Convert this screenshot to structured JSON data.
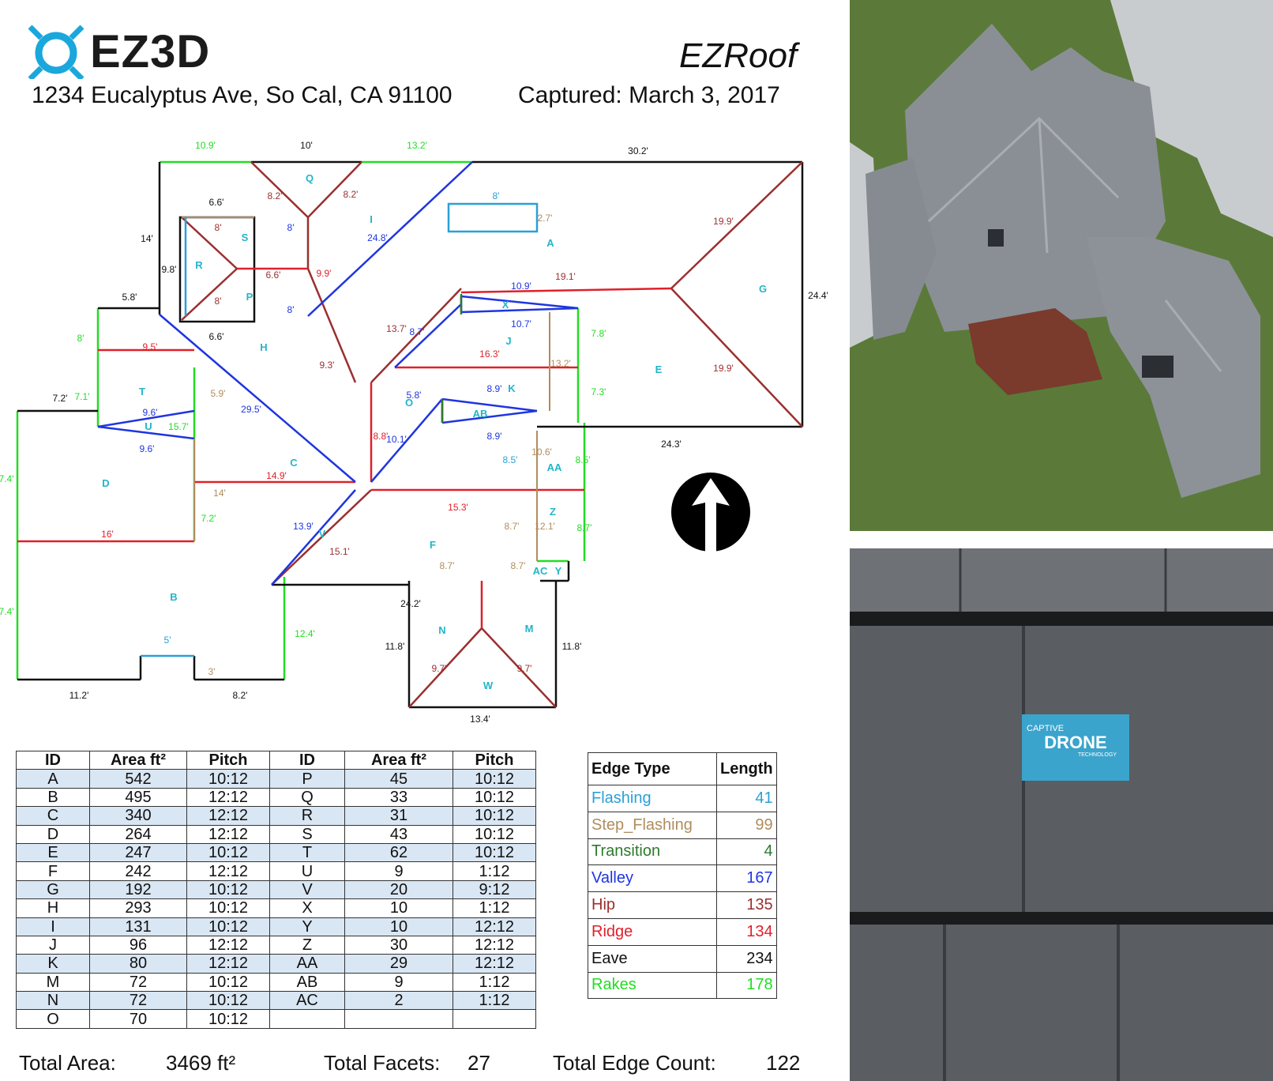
{
  "header": {
    "logo_text": "EZ3D",
    "address": "1234 Eucalyptus Ave, So Cal, CA 91100",
    "product": "EZRoof",
    "captured": "Captured: March 3, 2017"
  },
  "colors": {
    "flashing": "#2aa0d8",
    "step_flashing": "#b08d5c",
    "transition": "#2d7a2d",
    "valley": "#1f35e0",
    "hip": "#9b2f2f",
    "ridge": "#e0202a",
    "eave": "#111111",
    "rakes": "#22dd22",
    "facet_label": "#22b5c8",
    "row_highlight": "#d9e6f3"
  },
  "diagram": {
    "facet_labels": [
      "A",
      "B",
      "C",
      "D",
      "E",
      "F",
      "G",
      "H",
      "I",
      "J",
      "K",
      "M",
      "N",
      "O",
      "P",
      "Q",
      "R",
      "S",
      "T",
      "U",
      "V",
      "W",
      "X",
      "Y",
      "Z",
      "AA",
      "AB",
      "AC"
    ],
    "dimensions": {
      "top_rake_1": "10.9'",
      "top_eave_1": "10'",
      "top_rake_2": "13.2'",
      "top_eave_2": "30.2'",
      "right_eave": "24.4'",
      "left_14": "14'",
      "eave_5_8": "5.8'",
      "eave_6_6_top": "6.6'",
      "eave_6_6_bottom": "6.6'",
      "side_9_8": "9.8'",
      "hip_8_2a": "8.2'",
      "hip_8_2b": "8.2'",
      "valley_8a": "8'",
      "valley_8b": "8'",
      "hip_8a": "8'",
      "hip_8b": "8'",
      "ridge_6_6": "6.6'",
      "hip_9_9": "9.9'",
      "valley_24_8": "24.8'",
      "flash_8": "8'",
      "step_2_7": "2.7'",
      "hip_19_9a": "19.9'",
      "hip_19_9b": "19.9'",
      "ridge_19_1": "19.1'",
      "valley_10_9": "10.9'",
      "valley_10_7": "10.7'",
      "hip_13_7": "13.7'",
      "valley_8_7": "8.7'",
      "ridge_16_3": "16.3'",
      "step_13_2": "13.2'",
      "rake_7_8": "7.8'",
      "rake_7_3": "7.3'",
      "hip_9_3": "9.3'",
      "rake_8": "8'",
      "ridge_9_5": "9.5'",
      "step_5_9": "5.9'",
      "valley_29_5": "29.5'",
      "eave_7_2": "7.2'",
      "rake_7_1": "7.1'",
      "valley_9_6a": "9.6'",
      "valley_9_6b": "9.6'",
      "rake_15_7": "15.7'",
      "valley_5_8": "5.8'",
      "valley_8_9a": "8.9'",
      "valley_8_9b": "8.9'",
      "ridge_8_8": "8.8'",
      "valley_10_1": "10.1'",
      "step_10_6": "10.6'",
      "flash_8_5": "8.5'",
      "rake_8_5": "8.5'",
      "eave_24_3": "24.3'",
      "ridge_14_9": "14.9'",
      "step_14": "14'",
      "rake_7_4a": "7.4'",
      "rake_7_4b": "7.4'",
      "ridge_16": "16'",
      "rake_7_2": "7.2'",
      "ridge_15_3": "15.3'",
      "valley_13_9": "13.9'",
      "hip_15_1": "15.1'",
      "step_8_7": "8.7'",
      "step_12_1": "12.1'",
      "rake_8_7": "8.7'",
      "step_8_7_top_a": "8.7'",
      "step_8_7_top_b": "8.7'",
      "eave_24_2": "24.2'",
      "rake_12_4": "12.4'",
      "eave_11_8a": "11.8'",
      "eave_11_8b": "11.8'",
      "hip_9_7a": "9.7'",
      "hip_9_7b": "9.7'",
      "eave_13_4": "13.4'",
      "flash_5": "5'",
      "step_3": "3'",
      "eave_11_2": "11.2'",
      "eave_8_2": "8.2'"
    }
  },
  "facets_table": {
    "headers": [
      "ID",
      "Area ft²",
      "Pitch",
      "ID",
      "Area ft²",
      "Pitch"
    ],
    "rows": [
      [
        "A",
        "542",
        "10:12",
        "P",
        "45",
        "10:12"
      ],
      [
        "B",
        "495",
        "12:12",
        "Q",
        "33",
        "10:12"
      ],
      [
        "C",
        "340",
        "12:12",
        "R",
        "31",
        "10:12"
      ],
      [
        "D",
        "264",
        "12:12",
        "S",
        "43",
        "10:12"
      ],
      [
        "E",
        "247",
        "10:12",
        "T",
        "62",
        "10:12"
      ],
      [
        "F",
        "242",
        "12:12",
        "U",
        "9",
        "1:12"
      ],
      [
        "G",
        "192",
        "10:12",
        "V",
        "20",
        "9:12"
      ],
      [
        "H",
        "293",
        "10:12",
        "X",
        "10",
        "1:12"
      ],
      [
        "I",
        "131",
        "10:12",
        "Y",
        "10",
        "12:12"
      ],
      [
        "J",
        "96",
        "12:12",
        "Z",
        "30",
        "12:12"
      ],
      [
        "K",
        "80",
        "12:12",
        "AA",
        "29",
        "12:12"
      ],
      [
        "M",
        "72",
        "10:12",
        "AB",
        "9",
        "1:12"
      ],
      [
        "N",
        "72",
        "10:12",
        "AC",
        "2",
        "1:12"
      ],
      [
        "O",
        "70",
        "10:12",
        "",
        "",
        ""
      ]
    ]
  },
  "edges_table": {
    "headers": [
      "Edge Type",
      "Length"
    ],
    "rows": [
      {
        "type": "Flashing",
        "length": "41",
        "color": "#2aa0d8"
      },
      {
        "type": "Step_Flashing",
        "length": "99",
        "color": "#b08d5c"
      },
      {
        "type": "Transition",
        "length": "4",
        "color": "#2d7a2d"
      },
      {
        "type": "Valley",
        "length": "167",
        "color": "#1f35e0"
      },
      {
        "type": "Hip",
        "length": "135",
        "color": "#9b2f2f"
      },
      {
        "type": "Ridge",
        "length": "134",
        "color": "#e0202a"
      },
      {
        "type": "Eave",
        "length": "234",
        "color": "#111111"
      },
      {
        "type": "Rakes",
        "length": "178",
        "color": "#22dd22"
      }
    ]
  },
  "totals": {
    "area_label": "Total Area:",
    "area_value": "3469 ft²",
    "facets_label": "Total Facets:",
    "facets_value": "27",
    "edges_label": "Total Edge Count:",
    "edges_value": "122"
  },
  "closeup": {
    "badge_line1": "CAPTIVE",
    "badge_line2": "DRONE",
    "badge_line3": "TECHNOLOGY"
  }
}
